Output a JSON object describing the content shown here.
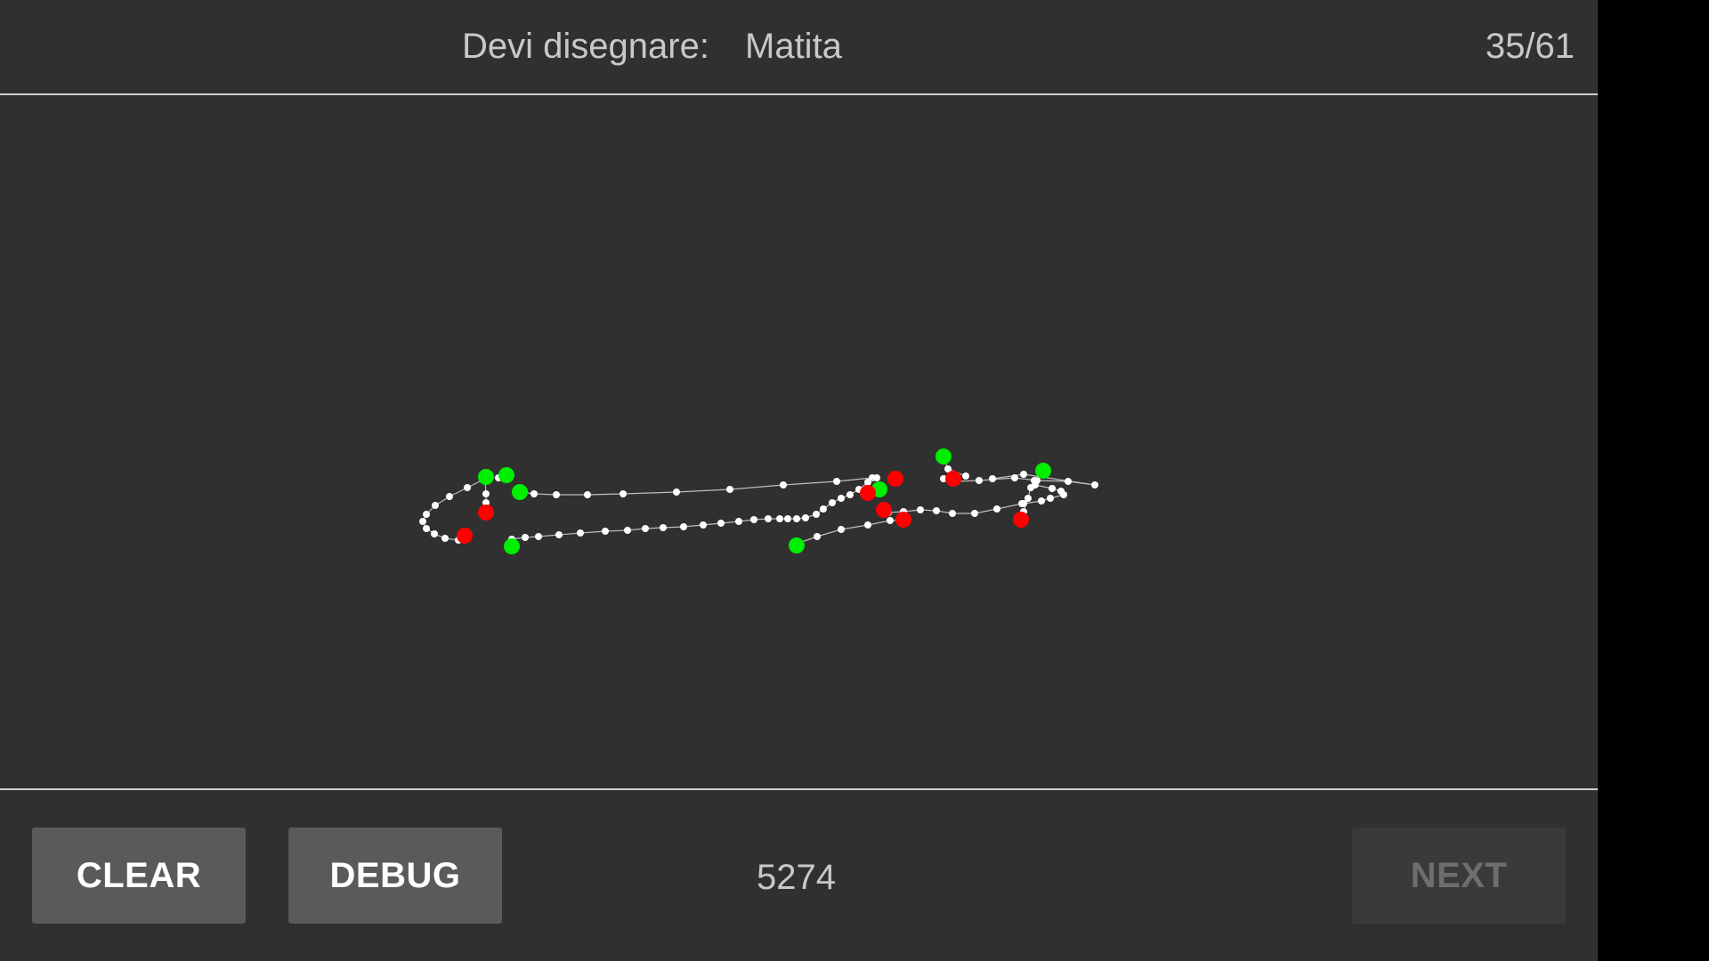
{
  "header": {
    "prompt_label": "Devi disegnare:",
    "prompt_word": "Matita",
    "progress": "35/61"
  },
  "footer": {
    "clear_label": "CLEAR",
    "debug_label": "DEBUG",
    "score": "5274",
    "next_label": "NEXT",
    "next_enabled": false
  },
  "colors": {
    "background": "#303030",
    "stroke_point": "#ffffff",
    "stroke_start": "#00ee00",
    "stroke_end": "#ff0000",
    "divider": "#d0d0d0"
  }
}
